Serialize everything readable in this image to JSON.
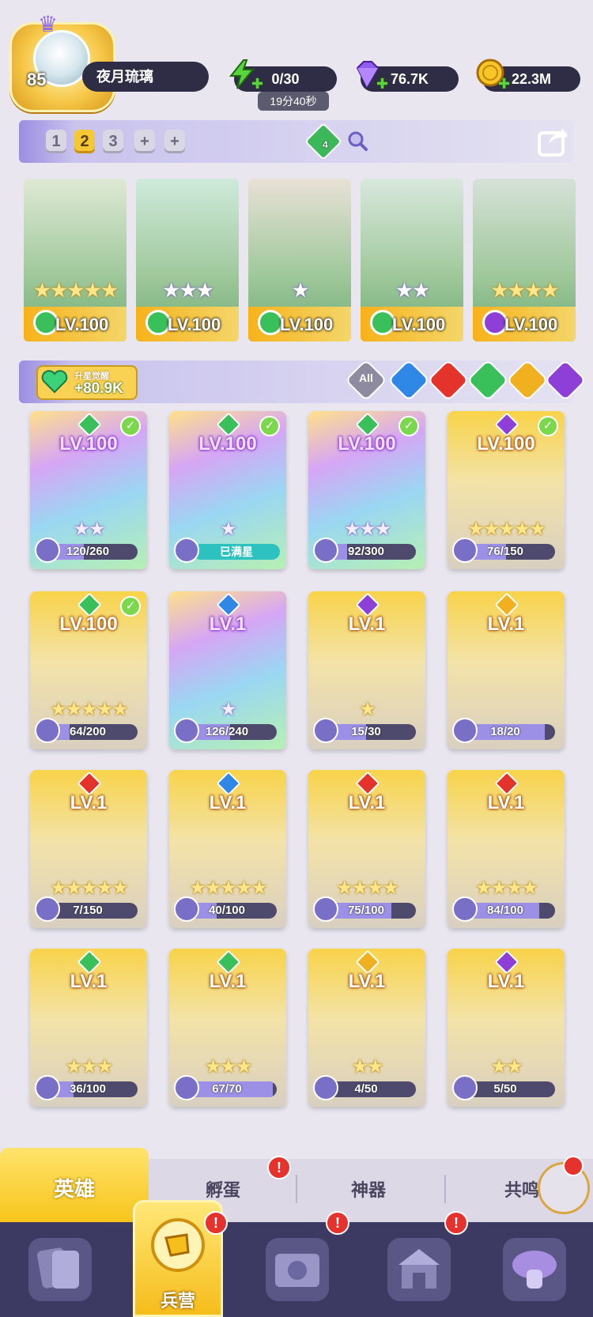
{
  "header": {
    "player_level": "85",
    "player_name": "夜月琉璃",
    "energy": "0/30",
    "energy_timer": "19分40秒",
    "gems": "76.7K",
    "gold": "22.3M"
  },
  "team_tabs": [
    "1",
    "2",
    "3"
  ],
  "team_active_index": 1,
  "team_extra_tabs": [
    "+",
    "+"
  ],
  "team_badge_count": "4",
  "team": [
    {
      "level": "LV.100",
      "element": "wind",
      "stars": "★★★★★",
      "star_type": "gold"
    },
    {
      "level": "LV.100",
      "element": "wind",
      "stars": "★★★",
      "star_type": "purple"
    },
    {
      "level": "LV.100",
      "element": "wind",
      "stars": "★",
      "star_type": "purple"
    },
    {
      "level": "LV.100",
      "element": "wind",
      "stars": "★★",
      "star_type": "purple"
    },
    {
      "level": "LV.100",
      "element": "dark",
      "stars": "★★★★",
      "star_type": "gold"
    }
  ],
  "awaken": {
    "label": "升星觉醒",
    "value": "+80.9K"
  },
  "filters": [
    "All",
    "water",
    "fire",
    "wind",
    "light",
    "dark"
  ],
  "filter_all_label": "All",
  "heroes": [
    {
      "level": "LV.100",
      "lv_style": "purple",
      "element": "wind",
      "checked": true,
      "stars": "★★",
      "star_type": "purple",
      "progress": "120/260",
      "fill": 0.46,
      "card": "rainbow"
    },
    {
      "level": "LV.100",
      "lv_style": "purple",
      "element": "wind",
      "checked": true,
      "stars": "★",
      "star_type": "purple",
      "progress": "",
      "maxed": "已满星",
      "card": "rainbow"
    },
    {
      "level": "LV.100",
      "lv_style": "purple",
      "element": "wind",
      "checked": true,
      "stars": "★★★",
      "star_type": "purple",
      "progress": "92/300",
      "fill": 0.31,
      "card": "rainbow"
    },
    {
      "level": "LV.100",
      "lv_style": "gold",
      "element": "dark",
      "checked": true,
      "stars": "★★★★★",
      "star_type": "gold",
      "progress": "76/150",
      "fill": 0.51,
      "card": "gold"
    },
    {
      "level": "LV.100",
      "lv_style": "gold",
      "element": "wind",
      "checked": true,
      "stars": "★★★★★",
      "star_type": "gold",
      "progress": "64/200",
      "fill": 0.32,
      "card": "gold"
    },
    {
      "level": "LV.1",
      "lv_style": "purple",
      "element": "water",
      "checked": false,
      "stars": "★",
      "star_type": "purple",
      "progress": "126/240",
      "fill": 0.53,
      "card": "rainbow"
    },
    {
      "level": "LV.1",
      "lv_style": "gold",
      "element": "dark",
      "checked": false,
      "stars": "★",
      "star_type": "gold",
      "progress": "15/30",
      "fill": 0.5,
      "card": "gold"
    },
    {
      "level": "LV.1",
      "lv_style": "gold",
      "element": "light",
      "checked": false,
      "stars": "",
      "star_type": "gold",
      "progress": "18/20",
      "fill": 0.9,
      "card": "gold"
    },
    {
      "level": "LV.1",
      "lv_style": "gold",
      "element": "fire",
      "checked": false,
      "stars": "★★★★★",
      "star_type": "gold",
      "progress": "7/150",
      "fill": 0.05,
      "card": "gold"
    },
    {
      "level": "LV.1",
      "lv_style": "gold",
      "element": "water",
      "checked": false,
      "stars": "★★★★★",
      "star_type": "gold",
      "progress": "40/100",
      "fill": 0.4,
      "card": "gold"
    },
    {
      "level": "LV.1",
      "lv_style": "gold",
      "element": "fire",
      "checked": false,
      "stars": "★★★★",
      "star_type": "gold",
      "progress": "75/100",
      "fill": 0.75,
      "card": "gold"
    },
    {
      "level": "LV.1",
      "lv_style": "gold",
      "element": "fire",
      "checked": false,
      "stars": "★★★★",
      "star_type": "gold",
      "progress": "84/100",
      "fill": 0.84,
      "card": "gold"
    },
    {
      "level": "LV.1",
      "lv_style": "gold",
      "element": "wind",
      "checked": false,
      "stars": "★★★",
      "star_type": "gold",
      "progress": "36/100",
      "fill": 0.36,
      "card": "gold"
    },
    {
      "level": "LV.1",
      "lv_style": "gold",
      "element": "wind",
      "checked": false,
      "stars": "★★★",
      "star_type": "gold",
      "progress": "67/70",
      "fill": 0.96,
      "card": "gold"
    },
    {
      "level": "LV.1",
      "lv_style": "gold",
      "element": "light",
      "checked": false,
      "stars": "★★",
      "star_type": "gold",
      "progress": "4/50",
      "fill": 0.08,
      "card": "gold"
    },
    {
      "level": "LV.1",
      "lv_style": "gold",
      "element": "dark",
      "checked": false,
      "stars": "★★",
      "star_type": "gold",
      "progress": "5/50",
      "fill": 0.1,
      "card": "gold"
    }
  ],
  "sub_tabs": [
    "英雄",
    "孵蛋",
    "神器",
    "共鸣"
  ],
  "bottom_nav": {
    "active_label": "兵营",
    "badge": "!"
  },
  "colors": {
    "wind": "#39c05a",
    "water": "#2f87e6",
    "fire": "#e4332a",
    "light": "#f0b020",
    "dark": "#8d3fd8",
    "accent": "#f4c835"
  }
}
